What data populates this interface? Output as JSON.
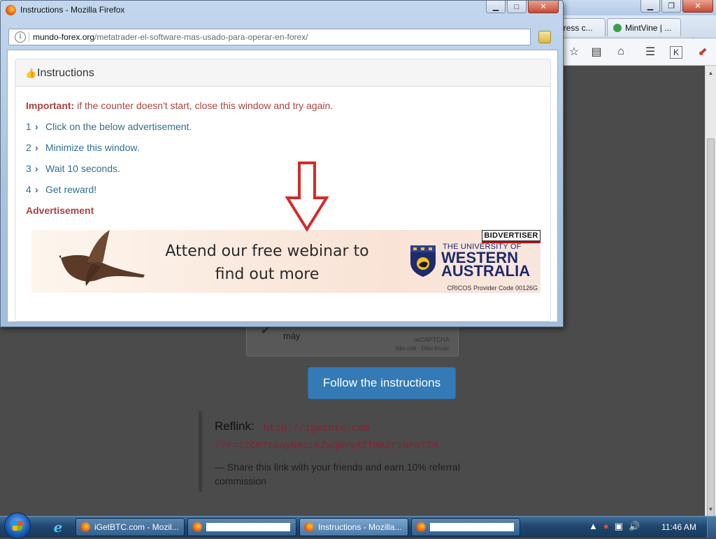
{
  "background_browser": {
    "tabs": [
      {
        "label": "dress c..."
      },
      {
        "label": "MintVine | ..."
      }
    ],
    "new_tab": "+",
    "page": {
      "captcha": {
        "label": "máy",
        "brand": "reCAPTCHA",
        "links": "Bảo mật - Điều khoản"
      },
      "follow_button": "Follow the instructions",
      "reflink": {
        "label": "Reflink:",
        "url_line1": "http://igetbtc.com",
        "url_line2": "/?r=12CR7tuoyNAzcKZwqmVy87THA2riNPaTTM",
        "share_text": "— Share this link with your friends and earn 10% referral commission"
      }
    }
  },
  "popup": {
    "title": "Instructions - Mozilla Firefox",
    "url_domain": "mundo-forex.org",
    "url_path": "/metatrader-el-software-mas-usado-para-operar-en-forex/",
    "panel": {
      "heading": "Instructions",
      "important_label": "Important:",
      "important_text": " if the counter doesn't start, close this window and try again.",
      "steps": [
        {
          "num": "1",
          "text": "Click on the below advertisement."
        },
        {
          "num": "2",
          "text": "Minimize this window."
        },
        {
          "num": "3",
          "text": "Wait 10 seconds."
        },
        {
          "num": "4",
          "text": "Get reward!"
        }
      ],
      "ad_heading": "Advertisement",
      "ad": {
        "headline_line1": "Attend our free webinar to",
        "headline_line2": "find out more",
        "badge": "BIDVERTISER",
        "uni_line1": "THE UNIVERSITY OF",
        "uni_line2": "WESTERN",
        "uni_line3": "AUSTRALIA",
        "cricos": "CRICOS Provider Code 00126G"
      }
    }
  },
  "taskbar": {
    "buttons": [
      {
        "label": "iGetBTC.com - Mozil..."
      },
      {
        "label": "Instructions - Mozilla..."
      }
    ],
    "clock": "11:46 AM"
  },
  "colors": {
    "accent_button": "#337ab7",
    "important_text": "#a94442",
    "step_text": "#31708f",
    "reflink_url": "#8a1f33"
  }
}
